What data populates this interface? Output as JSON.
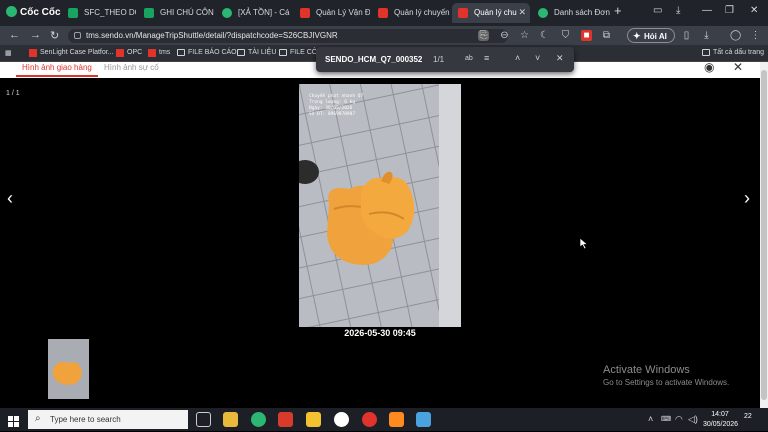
{
  "browser": {
    "brand": "Cốc Cốc",
    "tabs": [
      {
        "label": "SFC_THEO DÕI H",
        "color": "#1aa260"
      },
      {
        "label": "GHI CHÚ CÔNG",
        "color": "#1aa260"
      },
      {
        "label": "[XẢ TỒN] - Cá P",
        "color": "#2bb673"
      },
      {
        "label": "Quản Lý Vận Đơ",
        "color": "#e0332b"
      },
      {
        "label": "Quản lý chuyến",
        "color": "#e0332b"
      },
      {
        "label": "Quản lý chu",
        "color": "#e0332b"
      },
      {
        "label": "Danh sách Đơn",
        "color": "#2bb673"
      }
    ],
    "url": "tms.sendo.vn/ManageTripShuttle/detail/?dispatchcode=S26CBJIVGNR",
    "hoi_ai": "Hỏi AI",
    "bookmarks": [
      {
        "label": "SenLight Case Platfor...",
        "icon": "sendo-icon"
      },
      {
        "label": "OPC",
        "icon": "sendo-icon"
      },
      {
        "label": "tms",
        "icon": "sendo-icon"
      },
      {
        "label": "FILE BÁO CÁO",
        "icon": "folder-icon"
      },
      {
        "label": "TÀI LIỆU",
        "icon": "folder-icon"
      },
      {
        "label": "FILE CÔN",
        "icon": "folder-icon"
      }
    ],
    "all_bookmarks": "Tất cả dấu trang"
  },
  "find_bar": {
    "query": "SENDO_HCM_Q7_000352",
    "count": "1/1"
  },
  "page": {
    "tabs": [
      "Hình ảnh giao hàng",
      "Hình ảnh sự cố"
    ],
    "page_indicator": "1 / 1",
    "photo_overlay": [
      "Chuyển phát nhanh Q7",
      "Trọng lượng: 6 kg",
      "Ngày: 30/05/2026",
      "Số ĐT: 0969970987"
    ],
    "timestamp": "2026-05-30 09:45"
  },
  "watermark": {
    "title": "Activate Windows",
    "subtitle": "Go to Settings to activate Windows."
  },
  "taskbar": {
    "search_placeholder": "Type here to search",
    "time": "14:07",
    "date": "30/05/2026",
    "notifications": "22"
  },
  "colors": {
    "accent": "#e0332b",
    "chrome": "#20232a"
  }
}
